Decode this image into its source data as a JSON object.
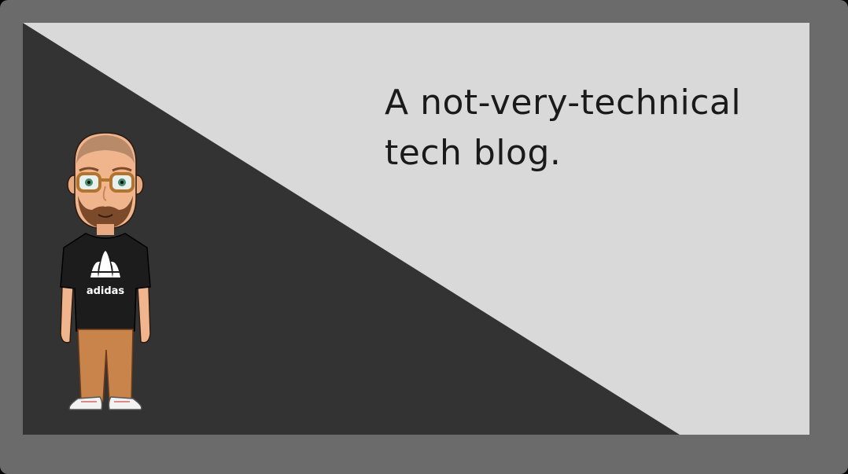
{
  "tagline": {
    "line1": "A not-very-technical",
    "line2": "tech blog."
  },
  "avatar": {
    "shirt_brand": "adidas"
  },
  "colors": {
    "frame": "#6b6b6b",
    "light_panel": "#d9d9d9",
    "dark_panel": "#333333",
    "text": "#1a1a1a"
  }
}
